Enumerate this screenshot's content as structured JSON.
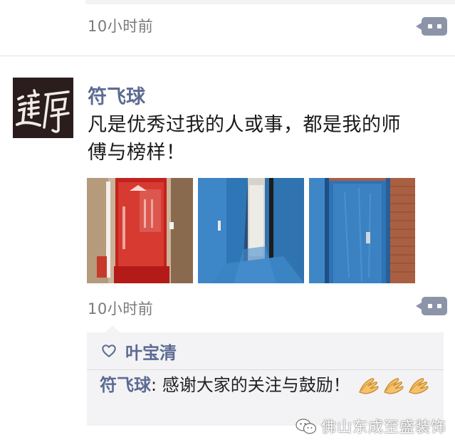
{
  "previous_post": {
    "time": "10小时前"
  },
  "post": {
    "avatar_text": "道厚",
    "author": "符飞球",
    "text_line1": "凡是优秀过我的人或事，都是我的师",
    "text_line2": "傅与榜样！",
    "time": "10小时前",
    "photos": [
      "photo-red-entrance",
      "photo-blue-doorway",
      "photo-blue-door"
    ]
  },
  "comments": {
    "likes": [
      "叶宝清"
    ],
    "items": [
      {
        "author": "符飞球",
        "separator": ": ",
        "text": "感谢大家的关注与鼓励！"
      }
    ]
  },
  "watermark": {
    "text": "佛山东成至盛装饰"
  },
  "colors": {
    "name_blue": "#5d6b93",
    "more_button": "#8c94a8",
    "comment_bg": "#f3f3f5"
  }
}
